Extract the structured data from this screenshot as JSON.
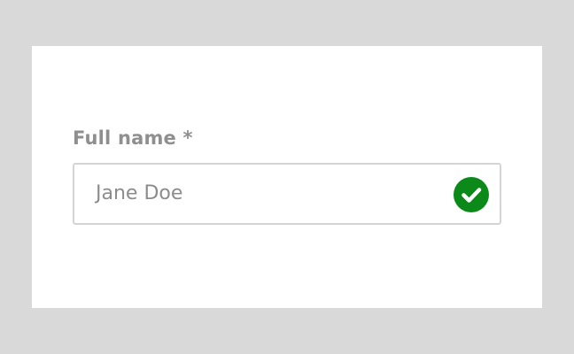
{
  "form": {
    "field_label": "Full name *",
    "field_value": "Jane Doe",
    "validation_state": "valid",
    "validation_icon": "check-circle-icon"
  },
  "colors": {
    "page_background": "#d9d9d9",
    "card_background": "#ffffff",
    "label_color": "#8f8f8f",
    "input_border": "#d4d4d4",
    "value_color": "#8c8c8c",
    "success_color": "#0b8a1a"
  }
}
